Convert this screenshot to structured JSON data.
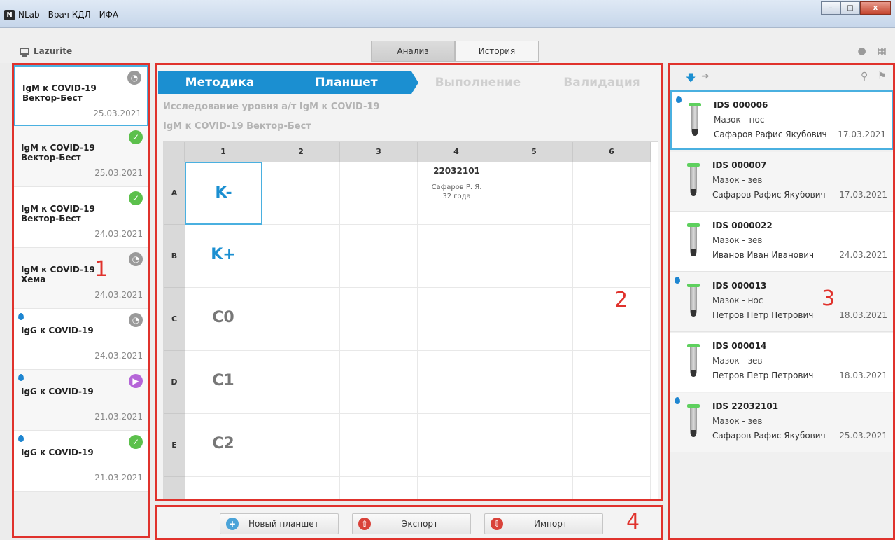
{
  "window": {
    "title": "NLab - Врач КДЛ - ИФА",
    "app_icon": "N",
    "btn_min": "–",
    "btn_max": "□",
    "btn_close": "x"
  },
  "toolbar": {
    "brand": "Lazurite",
    "tabs": [
      {
        "label": "Анализ",
        "active": true
      },
      {
        "label": "История",
        "active": false
      }
    ]
  },
  "left": {
    "items": [
      {
        "name": "IgM к COVID-19 Вектор-Бест",
        "date": "25.03.2021",
        "status": "clock",
        "drop": false
      },
      {
        "name": "IgM к COVID-19 Вектор-Бест",
        "date": "25.03.2021",
        "status": "ok",
        "drop": false
      },
      {
        "name": "IgM к COVID-19 Вектор-Бест",
        "date": "24.03.2021",
        "status": "ok",
        "drop": false
      },
      {
        "name": "IgM к COVID-19 Хема",
        "date": "24.03.2021",
        "status": "clock",
        "drop": false
      },
      {
        "name": "IgG к COVID-19",
        "date": "24.03.2021",
        "status": "clock",
        "drop": true
      },
      {
        "name": "IgG к COVID-19",
        "date": "21.03.2021",
        "status": "play",
        "drop": true
      },
      {
        "name": "IgG к COVID-19",
        "date": "21.03.2021",
        "status": "ok",
        "drop": true
      }
    ]
  },
  "center": {
    "steps": [
      "Методика",
      "Планшет",
      "Выполнение",
      "Валидация"
    ],
    "study_title": "Исследование уровня а/т IgM к COVID-19",
    "kit_title": "IgM к COVID-19 Вектор-Бест",
    "columns": [
      "1",
      "2",
      "3",
      "4",
      "5",
      "6"
    ],
    "rows": [
      "A",
      "B",
      "C",
      "D",
      "E"
    ],
    "controls": [
      "K-",
      "K+",
      "C0",
      "C1",
      "C2"
    ],
    "sample": {
      "id": "22032101",
      "patient": "Сафаров Р. Я.",
      "age": "32 года"
    }
  },
  "right": {
    "items": [
      {
        "id": "IDS 000006",
        "material": "Мазок - нос",
        "patient": "Сафаров Рафис Якубович",
        "date": "17.03.2021",
        "drop": true
      },
      {
        "id": "IDS 000007",
        "material": "Мазок - зев",
        "patient": "Сафаров Рафис Якубович",
        "date": "17.03.2021",
        "drop": false
      },
      {
        "id": "IDS 0000022",
        "material": "Мазок - зев",
        "patient": "Иванов Иван Иванович",
        "date": "24.03.2021",
        "drop": false
      },
      {
        "id": "IDS 000013",
        "material": "Мазок - нос",
        "patient": "Петров Петр Петрович",
        "date": "18.03.2021",
        "drop": true
      },
      {
        "id": "IDS 000014",
        "material": "Мазок - зев",
        "patient": "Петров Петр Петрович",
        "date": "18.03.2021",
        "drop": false
      },
      {
        "id": "IDS 22032101",
        "material": "Мазок - зев",
        "patient": "Сафаров Рафис Якубович",
        "date": "25.03.2021",
        "drop": true
      }
    ]
  },
  "bottom": {
    "new_plate": "Новый планшет",
    "export": "Экспорт",
    "import": "Импорт"
  },
  "markers": [
    "1",
    "2",
    "3",
    "4"
  ],
  "colors": {
    "accent": "#1b8fd1",
    "ok": "#5cc04c",
    "pending": "#9a9a9a",
    "running": "#b565d8",
    "annotation": "#e0322c"
  }
}
